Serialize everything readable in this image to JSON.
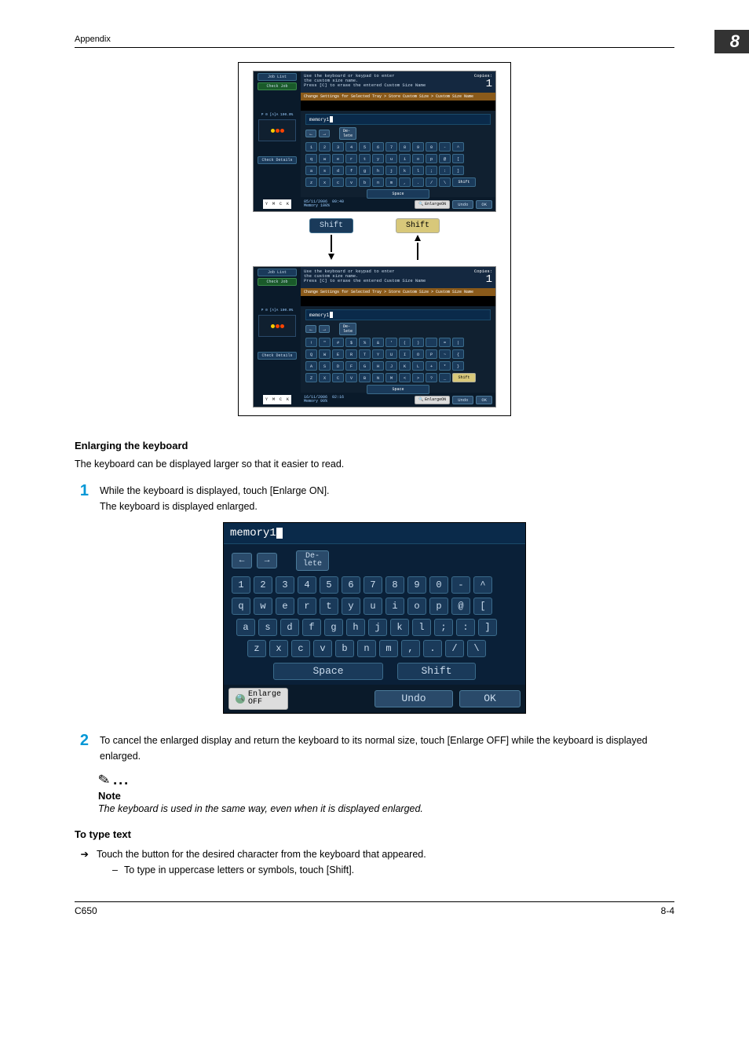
{
  "header": {
    "appendix": "Appendix",
    "chapter": "8"
  },
  "screenshot": {
    "job_list": "Job List",
    "check_job": "Check Job",
    "check_details": "Check Details",
    "status": "P 0 [A]A 100.0%",
    "message": "Use the keyboard or keypad to enter\nthe custom size name.\nPress [C] to erase the entered Custom Size Name",
    "copies_label": "Copies:",
    "copies_value": "1",
    "breadcrumb": "Change Settings for Selected Tray > Store Custom Size > Custom Size Name",
    "input_value": "memory1",
    "delete": "De-\nlete",
    "row1": [
      "1",
      "2",
      "3",
      "4",
      "5",
      "6",
      "7",
      "8",
      "9",
      "0",
      "-",
      "^"
    ],
    "row2": [
      "q",
      "w",
      "e",
      "r",
      "t",
      "y",
      "u",
      "i",
      "o",
      "p",
      "@",
      "["
    ],
    "row3": [
      "a",
      "s",
      "d",
      "f",
      "g",
      "h",
      "j",
      "k",
      "l",
      ";",
      ":",
      "]"
    ],
    "row4": [
      "z",
      "x",
      "c",
      "v",
      "b",
      "n",
      "m",
      ",",
      ".",
      "/",
      "\\"
    ],
    "row1s": [
      "!",
      "\"",
      "#",
      "$",
      "%",
      "&",
      "'",
      "(",
      ")",
      " ",
      "=",
      "|"
    ],
    "row2s": [
      "Q",
      "W",
      "E",
      "R",
      "T",
      "Y",
      "U",
      "I",
      "O",
      "P",
      "~",
      "{"
    ],
    "row3s": [
      "A",
      "S",
      "D",
      "F",
      "G",
      "H",
      "J",
      "K",
      "L",
      "+",
      "*",
      "}"
    ],
    "row4s": [
      "Z",
      "X",
      "C",
      "V",
      "B",
      "N",
      "M",
      "<",
      ">",
      "?",
      "_"
    ],
    "space": "Space",
    "shift": "Shift",
    "indicators": [
      "Y",
      "M",
      "C",
      "K"
    ],
    "date1": "05/11/2006",
    "time1": "09:40",
    "mem1": "Memory      100%",
    "date2": "16/11/2006",
    "time2": "02:16",
    "mem2": "Memory      99%",
    "enlarge_on": "EnlargeON",
    "undo": "Undo",
    "ok": "OK"
  },
  "arrows": {
    "shift_left": "Shift",
    "shift_right": "Shift"
  },
  "section": {
    "title": "Enlarging the keyboard",
    "intro": "The keyboard can be displayed larger so that it easier to read.",
    "step1_a": "While the keyboard is displayed, touch [Enlarge ON].",
    "step1_b": "The keyboard is displayed enlarged.",
    "step2": "To cancel the enlarged display and return the keyboard to its normal size, touch [Enlarge OFF] while the keyboard is displayed enlarged."
  },
  "enlarged_kb": {
    "input_value": "memory1",
    "delete": "De-\nlete",
    "row1": [
      "1",
      "2",
      "3",
      "4",
      "5",
      "6",
      "7",
      "8",
      "9",
      "0",
      "-",
      "^"
    ],
    "row2": [
      "q",
      "w",
      "e",
      "r",
      "t",
      "y",
      "u",
      "i",
      "o",
      "p",
      "@",
      "["
    ],
    "row3": [
      "a",
      "s",
      "d",
      "f",
      "g",
      "h",
      "j",
      "k",
      "l",
      ";",
      ":",
      "]"
    ],
    "row4": [
      "z",
      "x",
      "c",
      "v",
      "b",
      "n",
      "m",
      ",",
      ".",
      "/",
      "\\"
    ],
    "space": "Space",
    "shift": "Shift",
    "enlarge_off": "Enlarge\nOFF",
    "undo": "Undo",
    "ok": "OK"
  },
  "note": {
    "title": "Note",
    "text": "The keyboard is used in the same way, even when it is displayed enlarged."
  },
  "type_text": {
    "title": "To type text",
    "bullet": "Touch the button for the desired character from the keyboard that appeared.",
    "sub": "To type in uppercase letters or symbols, touch [Shift]."
  },
  "footer": {
    "left": "C650",
    "right": "8-4"
  }
}
